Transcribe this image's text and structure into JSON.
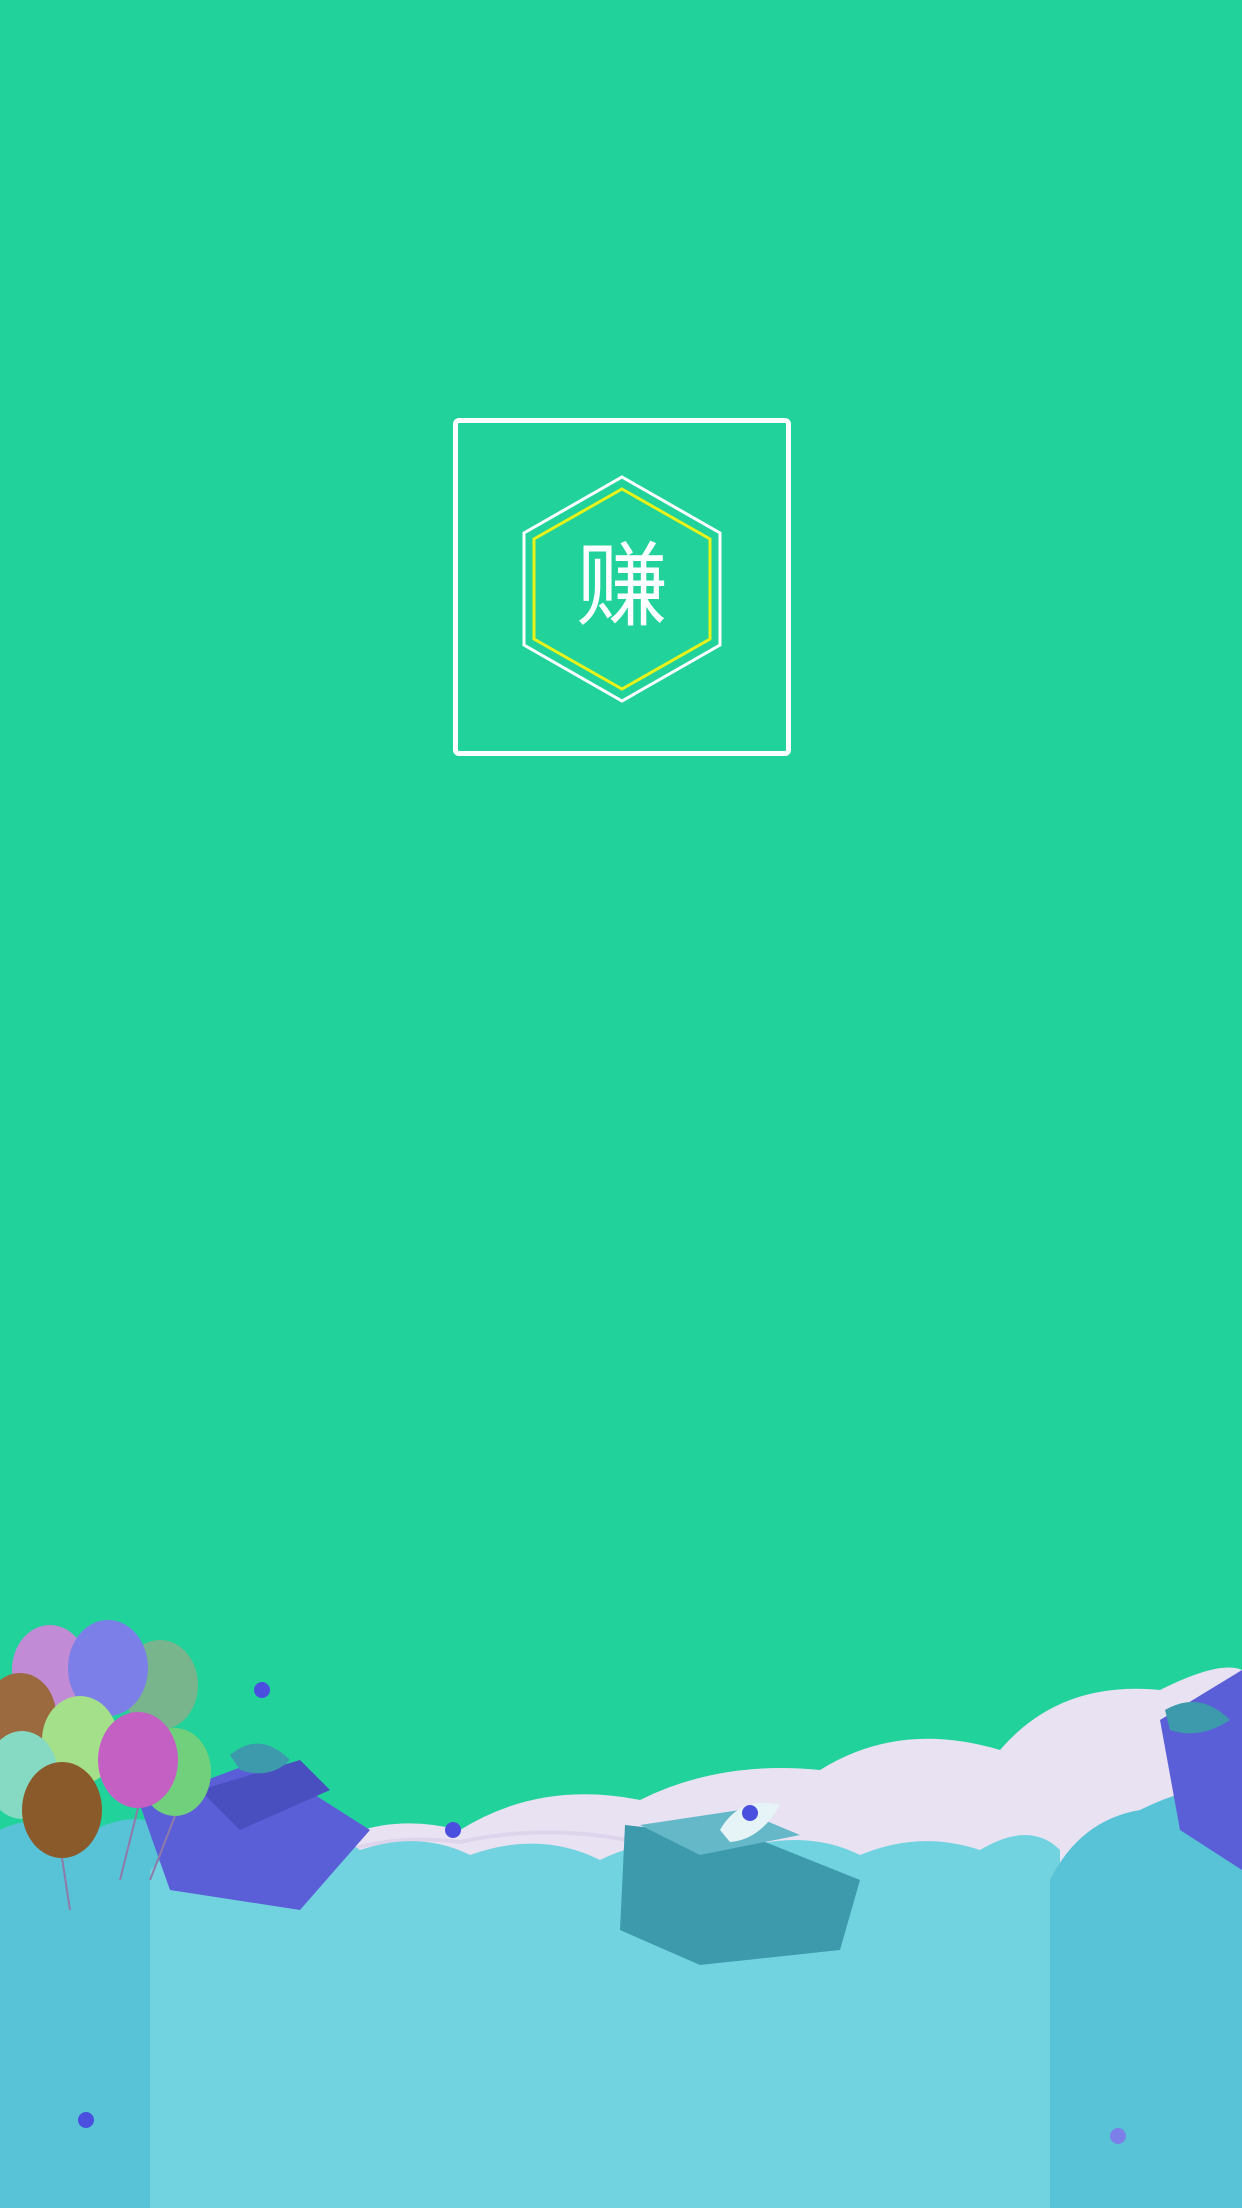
{
  "splash": {
    "logo_char": "赚",
    "colors": {
      "background": "#21d29b",
      "logo_border": "#ffffff",
      "logo_inner_hex": "#e6f21a",
      "cloud_light": "#72d3e0",
      "cloud_dark": "#58c3d6",
      "cloud_back": "#e9e2f2",
      "gift_blue": "#5a5fd8",
      "gift_teal": "#3c9aac"
    },
    "decorations": [
      "balloons-icon",
      "gift-box-icon",
      "cloud-icon",
      "confetti-dot-icon"
    ]
  }
}
